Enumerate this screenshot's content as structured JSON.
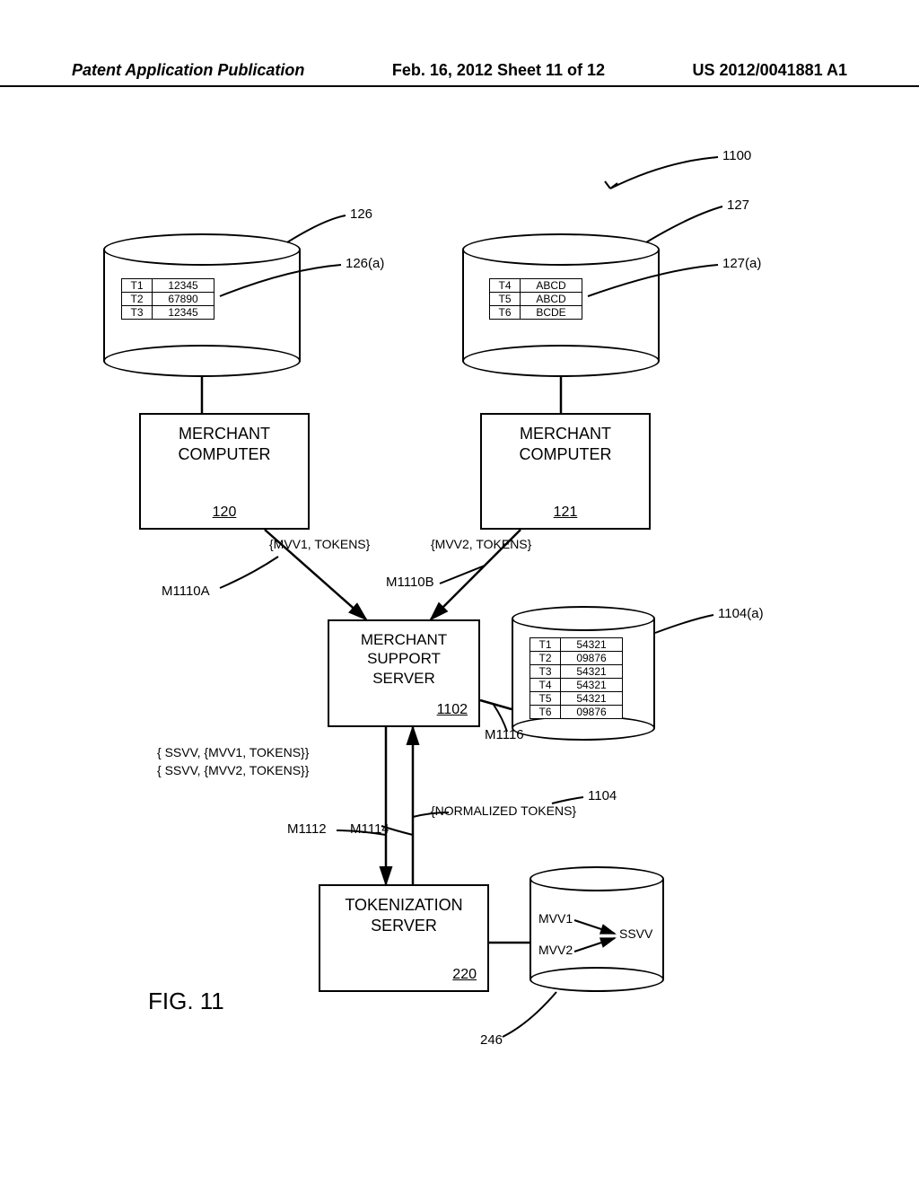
{
  "header": {
    "left": "Patent Application Publication",
    "center": "Feb. 16, 2012  Sheet 11 of 12",
    "right": "US 2012/0041881 A1"
  },
  "refs": {
    "system": "1100",
    "db126": "126",
    "tbl126a": "126(a)",
    "db127": "127",
    "tbl127a": "127(a)",
    "merchA_label": "MERCHANT\nCOMPUTER",
    "merchA_ref": "120",
    "merchB_label": "MERCHANT\nCOMPUTER",
    "merchB_ref": "121",
    "msgA": "{MVV1, TOKENS}",
    "msgB": "{MVV2, TOKENS}",
    "mA": "M1110A",
    "mB": "M1110B",
    "support_label": "MERCHANT\nSUPPORT\nSERVER",
    "support_ref": "1102",
    "m1116": "M1116",
    "db1104a": "1104(a)",
    "ssvvA": "{ SSVV, {MVV1, TOKENS}}",
    "ssvvB": "{ SSVV, {MVV2, TOKENS}}",
    "m1112": "M1112",
    "m1114": "M1114",
    "normtok": "{NORMALIZED TOKENS}",
    "n1104": "1104",
    "token_label": "TOKENIZATION\nSERVER",
    "token_ref": "220",
    "mvv1": "MVV1",
    "mvv2": "MVV2",
    "ssvv": "SSVV",
    "db246": "246",
    "figcap": "FIG. 11"
  },
  "table126a": [
    {
      "k": "T1",
      "v": "12345"
    },
    {
      "k": "T2",
      "v": "67890"
    },
    {
      "k": "T3",
      "v": "12345"
    }
  ],
  "table127a": [
    {
      "k": "T4",
      "v": "ABCD"
    },
    {
      "k": "T5",
      "v": "ABCD"
    },
    {
      "k": "T6",
      "v": "BCDE"
    }
  ],
  "table1104a": [
    {
      "k": "T1",
      "v": "54321"
    },
    {
      "k": "T2",
      "v": "09876"
    },
    {
      "k": "T3",
      "v": "54321"
    },
    {
      "k": "T4",
      "v": "54321"
    },
    {
      "k": "T5",
      "v": "54321"
    },
    {
      "k": "T6",
      "v": "09876"
    }
  ]
}
